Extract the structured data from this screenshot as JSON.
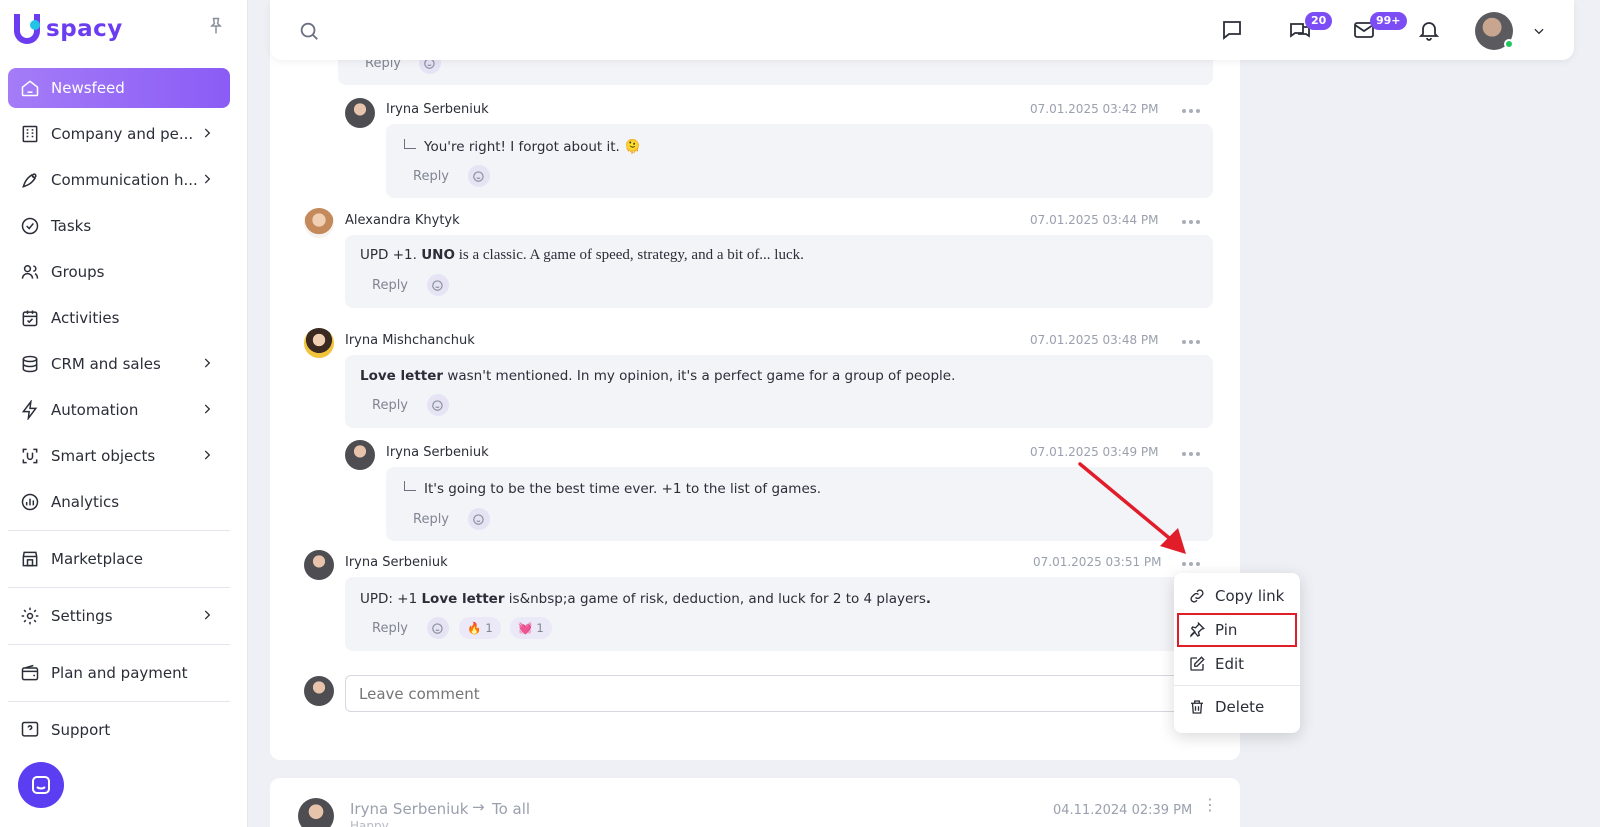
{
  "app": {
    "logo_text": "spacy"
  },
  "sidebar": {
    "items": [
      {
        "label": "Newsfeed",
        "icon": "home-icon",
        "active": true
      },
      {
        "label": "Company and pe...",
        "icon": "building-icon",
        "chevron": true
      },
      {
        "label": "Communication h...",
        "icon": "communication-icon",
        "chevron": true
      },
      {
        "label": "Tasks",
        "icon": "check-circle-icon"
      },
      {
        "label": "Groups",
        "icon": "users-icon"
      },
      {
        "label": "Activities",
        "icon": "calendar-icon"
      },
      {
        "label": "CRM and sales",
        "icon": "database-icon",
        "chevron": true
      },
      {
        "label": "Automation",
        "icon": "lightning-icon",
        "chevron": true
      },
      {
        "label": "Smart objects",
        "icon": "smart-object-icon",
        "chevron": true
      },
      {
        "label": "Analytics",
        "icon": "analytics-icon"
      },
      {
        "label": "Marketplace",
        "icon": "store-icon"
      },
      {
        "label": "Settings",
        "icon": "gear-icon",
        "chevron": true
      },
      {
        "label": "Plan and payment",
        "icon": "wallet-icon"
      },
      {
        "label": "Support",
        "icon": "help-icon"
      }
    ]
  },
  "topbar": {
    "chat_badge": "20",
    "mail_badge": "99+"
  },
  "comments": [
    {
      "author": "Iryna Serbeniuk",
      "time": "07.01.2025 03:42 PM",
      "text": "You're right! I forgot about it. 🫠",
      "reply_label": "Reply",
      "nested": true
    },
    {
      "author": "Alexandra Khytyk",
      "time": "07.01.2025 03:44 PM",
      "text_prefix": "UPD +1. ",
      "text_bold": "UNO",
      "text_rest": " is a classic. A game of speed, strategy, and a bit of... luck.",
      "reply_label": "Reply"
    },
    {
      "author": "Iryna Mishchanchuk",
      "time": "07.01.2025 03:48 PM",
      "text_bold": "Love letter",
      "text_rest": " wasn't mentioned. In my opinion, it's a perfect game for a group of people.",
      "reply_label": "Reply"
    },
    {
      "author": "Iryna Serbeniuk",
      "time": "07.01.2025 03:49 PM",
      "text": "It's going to be the best time ever. +1 to the list of games.",
      "reply_label": "Reply",
      "nested": true
    },
    {
      "author": "Iryna Serbeniuk",
      "time": "07.01.2025 03:51 PM",
      "text_prefix": "UPD: +1 ",
      "text_bold": "Love letter",
      "text_rest": " is&nbsp;a game of risk, deduction, and luck for 2 to 4 players",
      "text_end": ".",
      "reply_label": "Reply",
      "reactions": [
        {
          "emoji": "🔥",
          "count": "1"
        },
        {
          "emoji": "💓",
          "count": "1"
        }
      ]
    }
  ],
  "top_reply_label": "Reply",
  "comment_input": {
    "placeholder": "Leave comment"
  },
  "context_menu": {
    "items": [
      {
        "label": "Copy link",
        "icon": "link-icon"
      },
      {
        "label": "Pin",
        "icon": "pin-icon",
        "highlighted": true
      },
      {
        "label": "Edit",
        "icon": "edit-icon"
      },
      {
        "label": "Delete",
        "icon": "trash-icon"
      }
    ]
  },
  "next_post": {
    "author": "Iryna Serbeniuk",
    "audience": "To all",
    "time": "04.11.2024 02:39 PM",
    "subtitle": "Happy"
  },
  "colors": {
    "accent": "#7c4df5",
    "highlight_box": "#e11d2a",
    "arrow": "#e11d2a"
  }
}
